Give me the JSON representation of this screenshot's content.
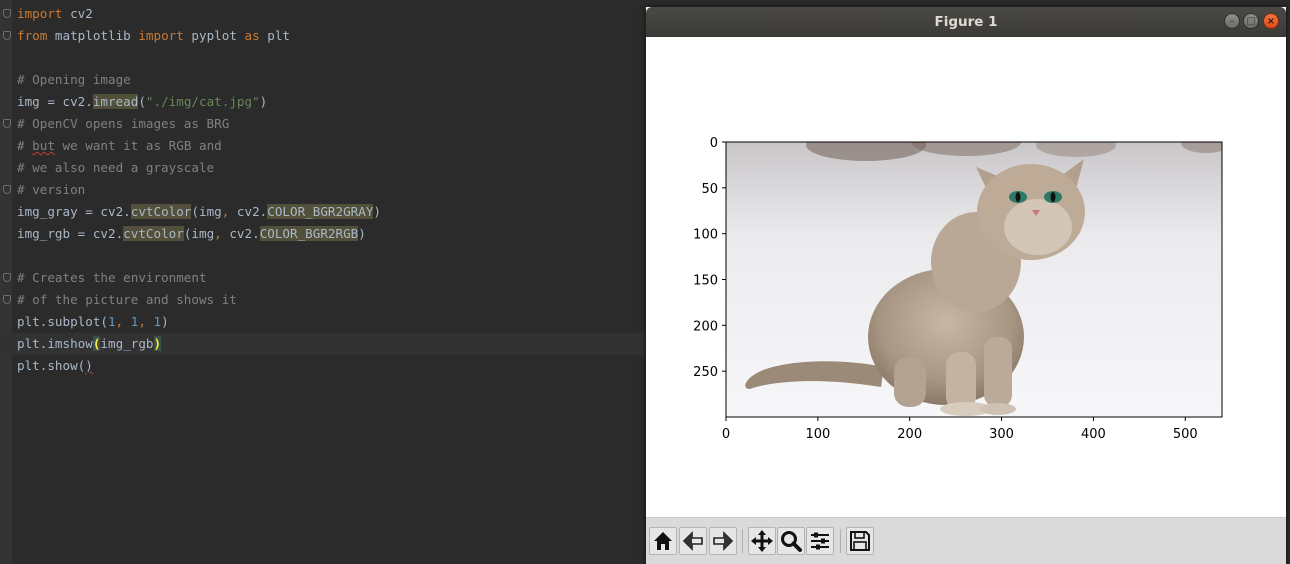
{
  "editor": {
    "lines": [
      {
        "fold": true,
        "tokens": [
          {
            "t": "import",
            "c": "kw"
          },
          {
            "t": " cv2"
          }
        ]
      },
      {
        "fold": true,
        "tokens": [
          {
            "t": "from",
            "c": "kw"
          },
          {
            "t": " matplotlib "
          },
          {
            "t": "import",
            "c": "kw"
          },
          {
            "t": " pyplot "
          },
          {
            "t": "as",
            "c": "kw"
          },
          {
            "t": " plt"
          }
        ]
      },
      {
        "fold": false,
        "tokens": []
      },
      {
        "fold": false,
        "tokens": [
          {
            "t": "# Opening image",
            "c": "cm"
          }
        ]
      },
      {
        "fold": false,
        "tokens": [
          {
            "t": "img = cv2."
          },
          {
            "t": "imread",
            "c": "hl"
          },
          {
            "t": "("
          },
          {
            "t": "\"./img/cat.jpg\"",
            "c": "st"
          },
          {
            "t": ")"
          }
        ]
      },
      {
        "fold": true,
        "tokens": [
          {
            "t": "# OpenCV opens images as BRG",
            "c": "cm"
          }
        ]
      },
      {
        "fold": false,
        "tokens": [
          {
            "t": "# ",
            "c": "cm"
          },
          {
            "t": "but",
            "c": "cm squig"
          },
          {
            "t": " we want it as RGB and",
            "c": "cm"
          }
        ]
      },
      {
        "fold": false,
        "tokens": [
          {
            "t": "# we also need a grayscale",
            "c": "cm"
          }
        ]
      },
      {
        "fold": true,
        "tokens": [
          {
            "t": "# version",
            "c": "cm"
          }
        ]
      },
      {
        "fold": false,
        "tokens": [
          {
            "t": "img_gray = cv2."
          },
          {
            "t": "cvtColor",
            "c": "hl"
          },
          {
            "t": "(img"
          },
          {
            "t": ",",
            "c": "kw"
          },
          {
            "t": " cv2."
          },
          {
            "t": "COLOR_BGR2GRAY",
            "c": "hl"
          },
          {
            "t": ")"
          }
        ]
      },
      {
        "fold": false,
        "tokens": [
          {
            "t": "img_rgb = cv2."
          },
          {
            "t": "cvtColor",
            "c": "hl"
          },
          {
            "t": "(img"
          },
          {
            "t": ",",
            "c": "kw"
          },
          {
            "t": " cv2."
          },
          {
            "t": "COLOR_BGR2RGB",
            "c": "hl"
          },
          {
            "t": ")"
          }
        ]
      },
      {
        "fold": false,
        "tokens": []
      },
      {
        "fold": true,
        "tokens": [
          {
            "t": "# Creates the environment",
            "c": "cm"
          }
        ]
      },
      {
        "fold": true,
        "tokens": [
          {
            "t": "# of the picture and shows it",
            "c": "cm"
          }
        ]
      },
      {
        "fold": false,
        "tokens": [
          {
            "t": "plt.subplot("
          },
          {
            "t": "1",
            "c": "nm"
          },
          {
            "t": ", ",
            "c": "kw"
          },
          {
            "t": "1",
            "c": "nm"
          },
          {
            "t": ", ",
            "c": "kw"
          },
          {
            "t": "1",
            "c": "nm"
          },
          {
            "t": ")"
          }
        ]
      },
      {
        "fold": false,
        "current": true,
        "tokens": [
          {
            "t": "plt.imshow"
          },
          {
            "t": "(",
            "c": "brace"
          },
          {
            "t": "img_rgb"
          },
          {
            "t": ")",
            "c": "brace"
          }
        ]
      },
      {
        "fold": false,
        "tokens": [
          {
            "t": "plt.show("
          },
          {
            "t": ")",
            "c": "squig"
          }
        ]
      }
    ]
  },
  "figure": {
    "title": "Figure 1",
    "buttons": {
      "minimize": "–",
      "maximize": "□",
      "close": "×"
    },
    "x_ticks": [
      "0",
      "100",
      "200",
      "300",
      "400",
      "500"
    ],
    "y_ticks": [
      "0",
      "50",
      "100",
      "150",
      "200",
      "250"
    ],
    "image_description": "cat sitting on snow",
    "toolbar": [
      "home-icon",
      "back-icon",
      "forward-icon",
      "pan-icon",
      "zoom-icon",
      "configure-subplots-icon",
      "save-icon"
    ]
  }
}
